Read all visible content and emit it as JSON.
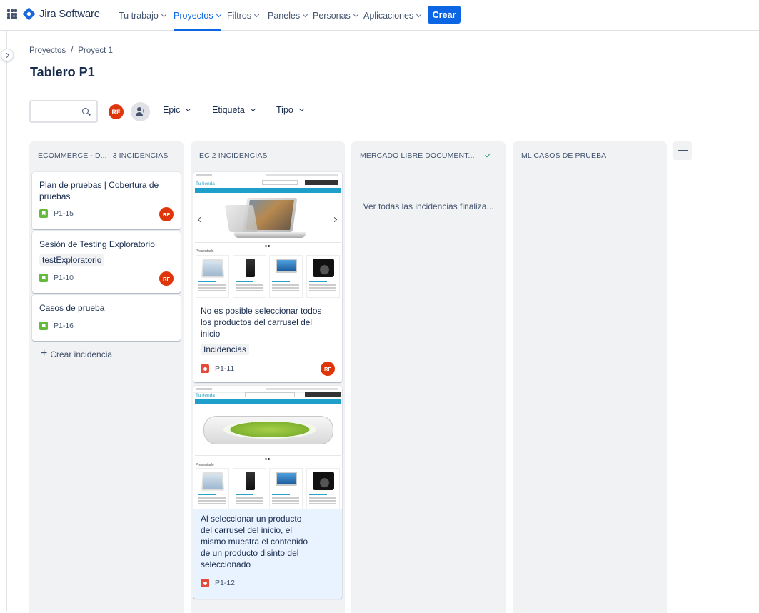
{
  "nav": {
    "product": "Jira Software",
    "items": [
      {
        "label": "Tu trabajo"
      },
      {
        "label": "Proyectos"
      },
      {
        "label": "Filtros"
      },
      {
        "label": "Paneles"
      },
      {
        "label": "Personas"
      },
      {
        "label": "Aplicaciones"
      }
    ],
    "active": "Proyectos",
    "create": "Crear"
  },
  "breadcrumb": [
    "Proyectos",
    "Proyect 1"
  ],
  "title": "Tablero P1",
  "toolbar": {
    "avatar": "RF",
    "filters": [
      "Epic",
      "Etiqueta",
      "Tipo"
    ]
  },
  "columns": [
    {
      "title": "ECOMMERCE - D...",
      "count": "3 INCIDENCIAS",
      "cards": [
        {
          "title": "Plan de pruebas | Cobertura de pruebas",
          "key": "P1-15",
          "type": "story",
          "assignee": "RF"
        },
        {
          "title": "Sesión de Testing Exploratorio",
          "label": "testExploratorio",
          "key": "P1-10",
          "type": "story",
          "assignee": "RF"
        },
        {
          "title": "Casos de prueba",
          "key": "P1-16",
          "type": "story"
        }
      ],
      "create_label": "Crear incidencia"
    },
    {
      "title": "EC 2 INCIDENCIAS",
      "cards": [
        {
          "title": "No es posible seleccionar todos los productos del carrusel del inicio",
          "label": "Incidencias",
          "key": "P1-11",
          "type": "bug",
          "assignee": "RF",
          "cover": {
            "brand": "Tu tienda",
            "heading": "Presentado"
          }
        },
        {
          "title": "Al seleccionar un producto del carrusel del inicio, el mismo muestra el contenido de un producto disinto del seleccionado",
          "key": "P1-12",
          "type": "bug",
          "cover": {
            "brand": "Tu tienda",
            "heading": "Presentado"
          }
        }
      ]
    },
    {
      "title": "MERCADO LIBRE DOCUMENT...",
      "done_link": "Ver todas las incidencias finaliza..."
    },
    {
      "title": "ML CASOS DE PRUEBA"
    }
  ],
  "colors": {
    "accent": "#0c66e4",
    "avatar": "#de350b",
    "story": "#63ba3c",
    "bug": "#e5493a"
  }
}
